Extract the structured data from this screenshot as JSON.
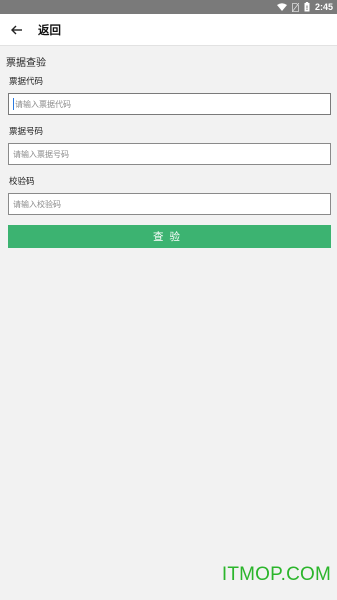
{
  "status_bar": {
    "time": "2:45"
  },
  "app_bar": {
    "title": "返回"
  },
  "form": {
    "section_title": "票据查验",
    "fields": [
      {
        "label": "票据代码",
        "placeholder": "请输入票据代码",
        "value": ""
      },
      {
        "label": "票据号码",
        "placeholder": "请输入票据号码",
        "value": ""
      },
      {
        "label": "校验码",
        "placeholder": "请输入校验码",
        "value": ""
      }
    ],
    "submit_label": "查验"
  },
  "watermark": "ITMOP.COM",
  "colors": {
    "accent": "#3cb371",
    "status_bar": "#7a7a7a",
    "watermark": "#2bb52b"
  },
  "icons": [
    "wifi-icon",
    "no-sim-icon",
    "battery-icon",
    "arrow-back-icon"
  ]
}
